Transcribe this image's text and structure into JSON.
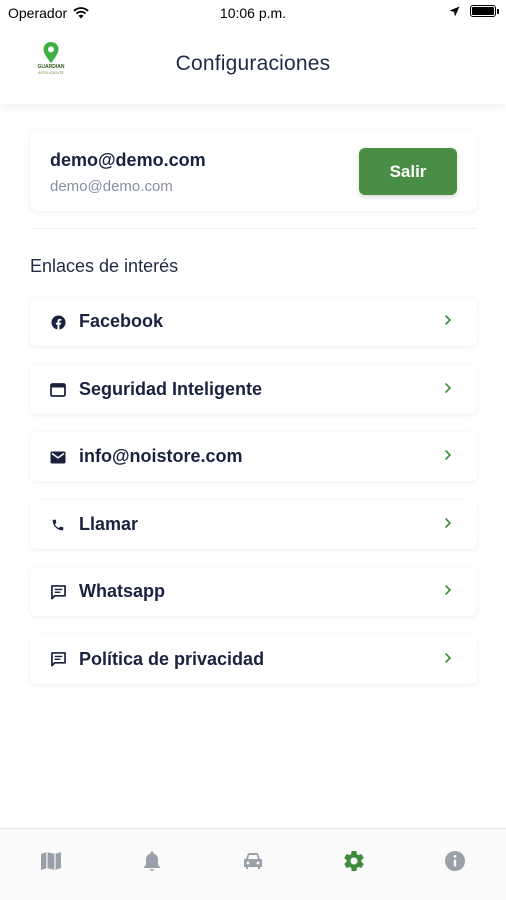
{
  "status_bar": {
    "carrier": "Operador",
    "time": "10:06 p.m."
  },
  "header": {
    "title": "Configuraciones",
    "logo_text": "GUARDIAN",
    "logo_subtext": "INTELIGENTE"
  },
  "user": {
    "email_primary": "demo@demo.com",
    "email_secondary": "demo@demo.com",
    "logout_label": "Salir"
  },
  "links_section": {
    "title": "Enlaces de interés",
    "items": [
      {
        "label": "Facebook",
        "icon": "facebook-icon"
      },
      {
        "label": "Seguridad Inteligente",
        "icon": "browser-icon"
      },
      {
        "label": "info@noistore.com",
        "icon": "mail-icon"
      },
      {
        "label": "Llamar",
        "icon": "phone-icon"
      },
      {
        "label": "Whatsapp",
        "icon": "chat-icon"
      },
      {
        "label": "Política de privacidad",
        "icon": "chat-icon"
      }
    ]
  },
  "tab_bar": {
    "tabs": [
      {
        "icon": "map-icon",
        "active": false
      },
      {
        "icon": "bell-icon",
        "active": false
      },
      {
        "icon": "car-icon",
        "active": false
      },
      {
        "icon": "gear-icon",
        "active": true
      },
      {
        "icon": "info-icon",
        "active": false
      }
    ]
  },
  "colors": {
    "accent": "#4a8e46",
    "active_tab": "#3f8a3c",
    "inactive_tab": "#9aa0a8",
    "text_dark": "#1a2240",
    "text_muted": "#8a8fa3"
  }
}
